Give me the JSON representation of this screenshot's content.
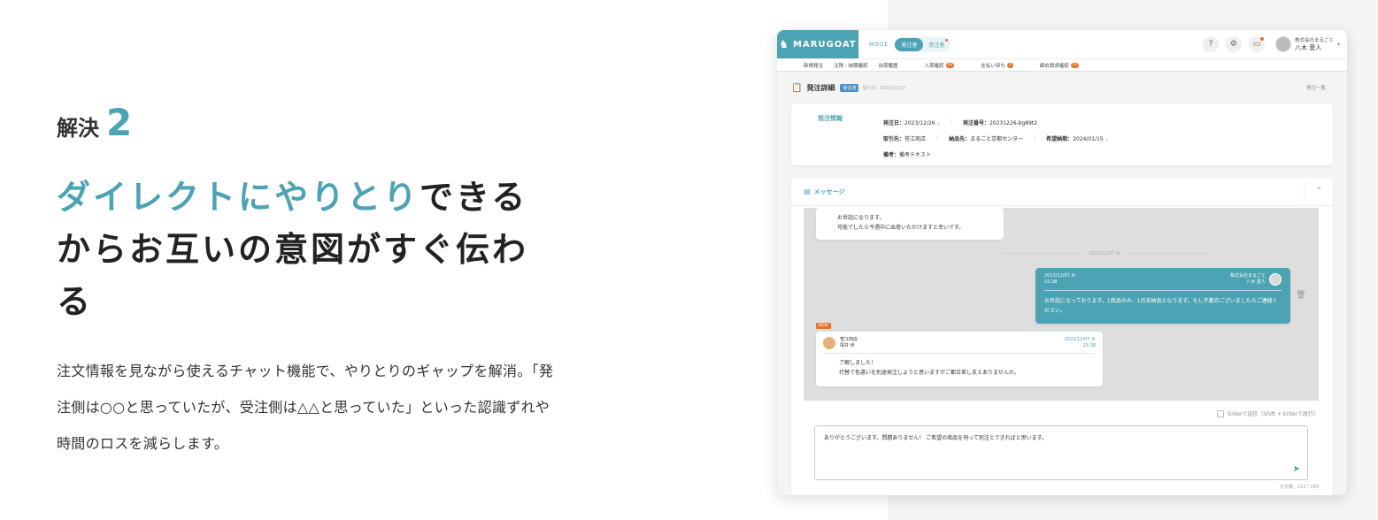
{
  "left": {
    "kicker_text": "解決",
    "kicker_num": "2",
    "headline_accent": "ダイレクトにやりとり",
    "headline_rest": "できるからお互いの意図がすぐ伝わる",
    "description": "注文情報を見ながら使えるチャット機能で、やりとりのギャップを解消。「発注側は○○と思っていたが、受注側は△△と思っていた」といった認識ずれや時間のロスを減らします。"
  },
  "app": {
    "logo": "MARUGOAT",
    "mode_label": "MODE",
    "mode_on": "発注者",
    "mode_off": "受注者",
    "help": "?",
    "user_company": "株式会社まるごと",
    "user_name": "八木 愛人",
    "subnav": [
      {
        "label": "新規発注"
      },
      {
        "label": "注残・納期確認"
      },
      {
        "label": "出荷履歴"
      },
      {
        "label": "入荷確認",
        "badge": "11"
      },
      {
        "label": "支払い待ち",
        "badge": "1"
      },
      {
        "label": "締め請求確認",
        "badge": "11"
      }
    ],
    "page_title": "発注詳細",
    "status": "受注済",
    "received": "受付日：2023/12/27",
    "list_link": "発注一覧",
    "order": {
      "title": "発注情報",
      "order_date_label": "発注日：",
      "order_date": "2023/12/26",
      "order_no_label": "発注番号：",
      "order_no": "20231226-bg89t2",
      "partner_label": "取引先：",
      "partner": "笹江商店",
      "delivery_label": "納品先：",
      "delivery": "まるごと京都センター",
      "due_label": "希望納期：",
      "due": "2024/01/15",
      "note_label": "備考：",
      "note": "備考テキスト"
    },
    "messages": {
      "title": "メッセージ",
      "m1_line1": "お世話になります。",
      "m1_line2": "可能でしたら今週中に出荷いただけますと幸いです。",
      "divider": "2023/12/07 木",
      "m2_date": "2023/12/07 木",
      "m2_time": "15:38",
      "m2_company": "株式会社まるごと",
      "m2_name": "八木 愛人",
      "m2_body": "お世話になっております。1商品のみ、1月末納品となります。もし不都合ございましたらご連絡ください。",
      "new_tag": "NEW",
      "m3_company": "笹江商店",
      "m3_name": "塚井 歩",
      "m3_date": "2023/12/07 木",
      "m3_time": "15:38",
      "m3_line1": "了解しました！",
      "m3_line2": "代替で色違いを別途発注しようと思いますがご都合差し支えありませんか。",
      "enter_option": "Enterで送信（Shift + Enterで改行）",
      "composer_text": "ありがとうございます。問題ありません！ ご希望の商品を伺って別注とできればと思います。",
      "char_count": "文字数：212 / 255"
    }
  },
  "colors": {
    "accent": "#4ba3b3",
    "orange": "#e8742c",
    "status_blue": "#4a90c8"
  }
}
